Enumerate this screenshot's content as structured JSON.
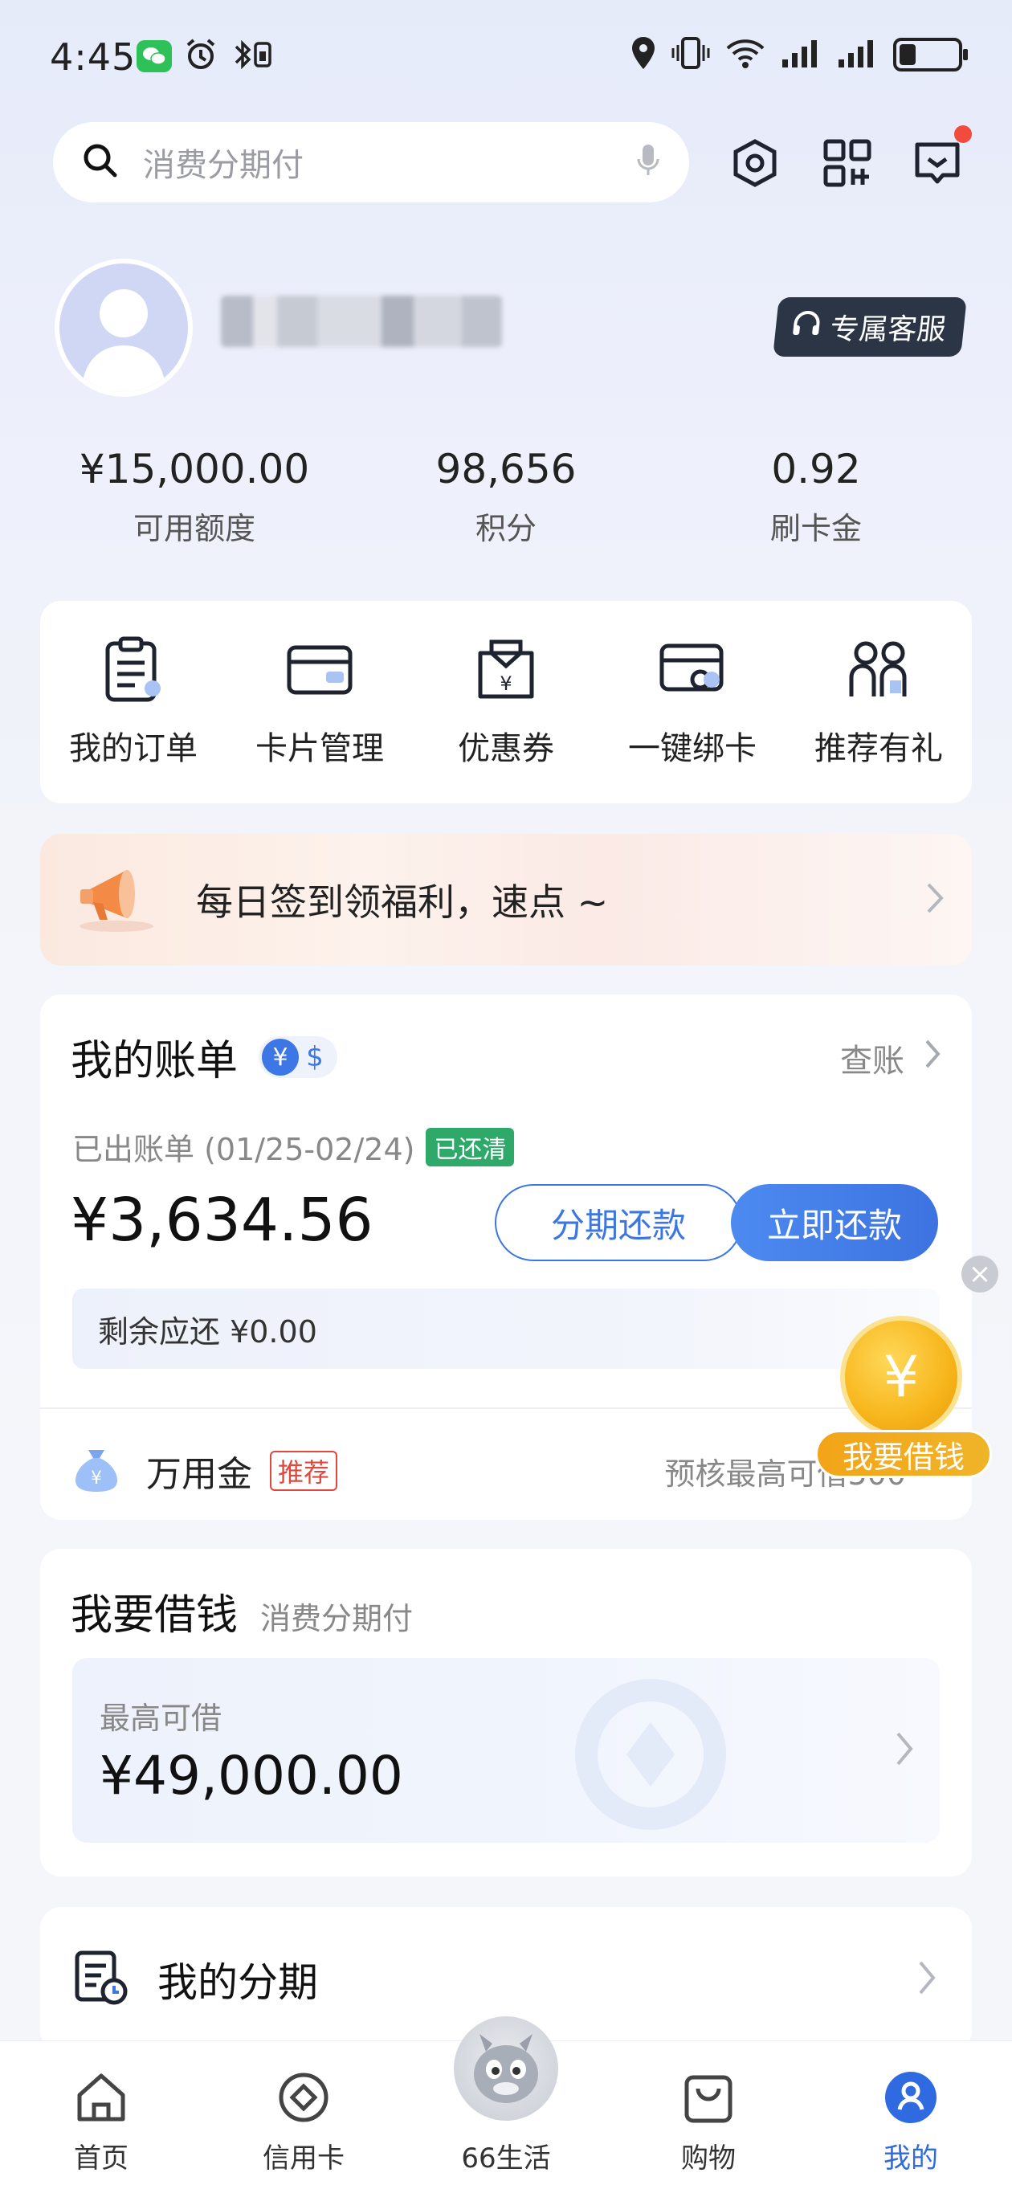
{
  "status_bar": {
    "time": "4:45"
  },
  "search": {
    "placeholder": "消费分期付"
  },
  "profile": {
    "service_label": "专属客服"
  },
  "stats": [
    {
      "value": "¥15,000.00",
      "label": "可用额度"
    },
    {
      "value": "98,656",
      "label": "积分"
    },
    {
      "value": "0.92",
      "label": "刷卡金"
    }
  ],
  "quick_menu": [
    {
      "label": "我的订单",
      "icon": "order-icon"
    },
    {
      "label": "卡片管理",
      "icon": "card-icon"
    },
    {
      "label": "优惠券",
      "icon": "coupon-icon"
    },
    {
      "label": "一键绑卡",
      "icon": "bind-card-icon"
    },
    {
      "label": "推荐有礼",
      "icon": "referral-icon"
    }
  ],
  "banner": {
    "text": "每日签到领福利，速点 ~"
  },
  "bill": {
    "title": "我的账单",
    "currency_yen": "¥",
    "currency_usd": "$",
    "check_label": "查账",
    "period": "已出账单 (01/25-02/24)",
    "status": "已还清",
    "amount": "¥3,634.56",
    "install_button": "分期还款",
    "pay_button": "立即还款",
    "remaining": "剩余应还 ¥0.00",
    "wanyong_name": "万用金",
    "wanyong_badge": "推荐",
    "wanyong_desc": "预核最高可借500"
  },
  "borrow_float": {
    "label": "我要借钱",
    "coin": "¥"
  },
  "loan": {
    "title": "我要借钱",
    "subtitle": "消费分期付",
    "label": "最高可借",
    "amount": "¥49,000.00"
  },
  "installments": {
    "title": "我的分期"
  },
  "bottom_nav": [
    {
      "label": "首页",
      "icon": "home-icon"
    },
    {
      "label": "信用卡",
      "icon": "credit-card-icon"
    },
    {
      "label": "66生活",
      "icon": "mascot-icon"
    },
    {
      "label": "购物",
      "icon": "shopping-bag-icon"
    },
    {
      "label": "我的",
      "icon": "profile-icon",
      "active": true
    }
  ],
  "colors": {
    "accent": "#3d77e6",
    "paid": "#2fa96a",
    "recommend": "#e0483e",
    "coin": "#f7b51a"
  }
}
